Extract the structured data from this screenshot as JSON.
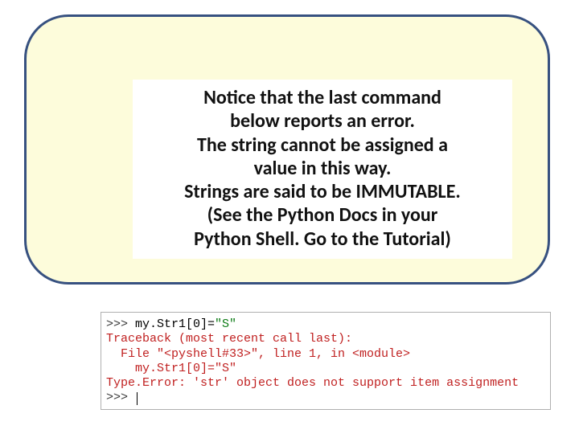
{
  "callout": {
    "l1": "Notice that the last command",
    "l2": "below reports an error.",
    "l3": "The string cannot be assigned a",
    "l4": "value in this way.",
    "l5": "Strings are said to be IMMUTABLE.",
    "l6": "(See the Python Docs in your",
    "l7": "Python Shell. Go to the Tutorial)"
  },
  "code": {
    "prompt": ">>> ",
    "input1_part1": "my.Str1[0]=",
    "input1_part2": "\"S\"",
    "tb1": "Traceback (most recent call last):",
    "tb2": "  File \"<pyshell#33>\", line 1, in <module>",
    "tb3": "    my.Str1[0]=\"S\"",
    "tb4": "Type.Error: 'str' object does not support item assignment",
    "prompt2": ">>> "
  }
}
